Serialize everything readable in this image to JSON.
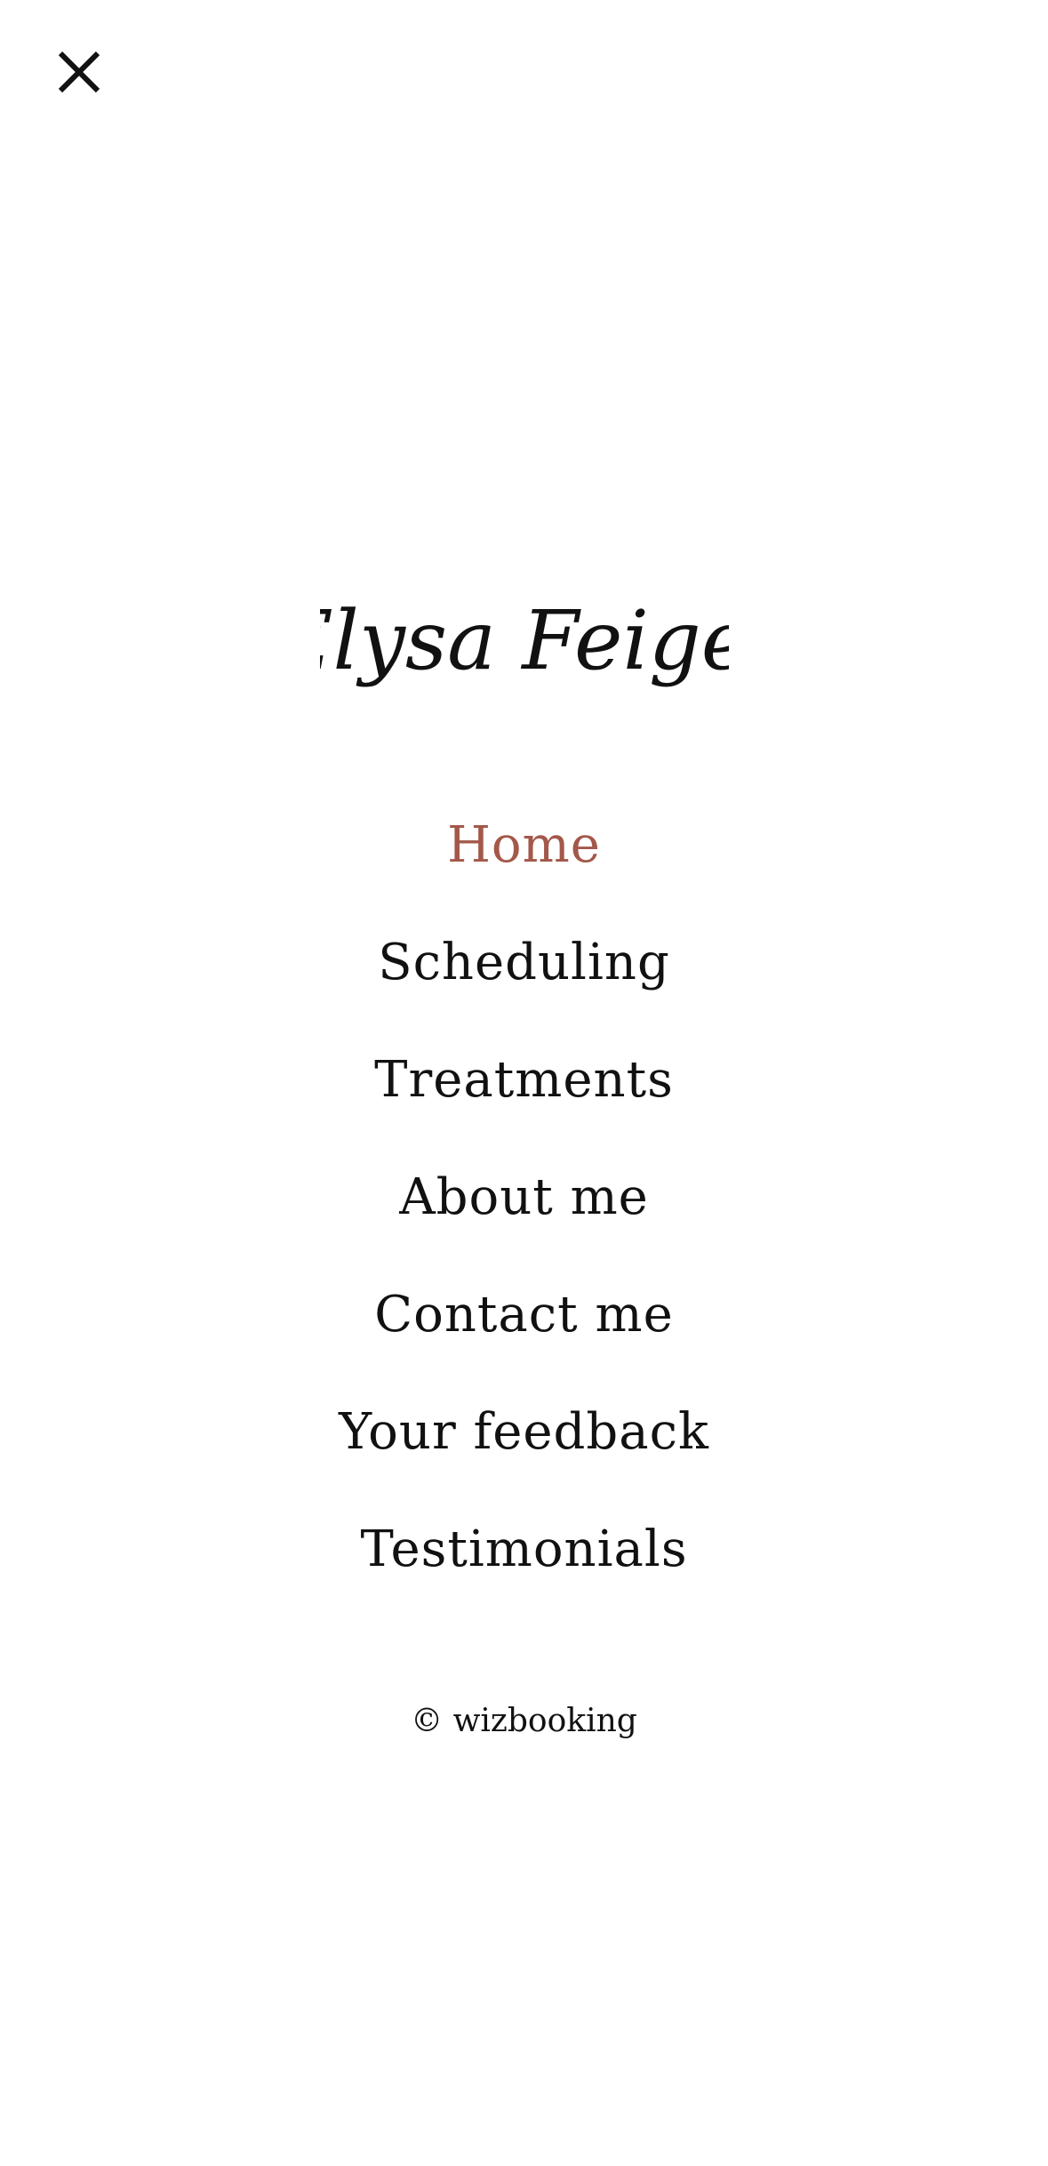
{
  "header": {
    "close_icon": "close-icon"
  },
  "brand": {
    "name": "Elysa Feigel"
  },
  "nav": {
    "items": [
      {
        "label": "Home",
        "active": true
      },
      {
        "label": "Scheduling",
        "active": false
      },
      {
        "label": "Treatments",
        "active": false
      },
      {
        "label": "About me",
        "active": false
      },
      {
        "label": "Contact me",
        "active": false
      },
      {
        "label": "Your feedback",
        "active": false
      },
      {
        "label": "Testimonials",
        "active": false
      }
    ]
  },
  "footer": {
    "copyright": "© wizbooking"
  },
  "colors": {
    "background": "#ffffff",
    "text": "#111111",
    "active": "#a3584a"
  }
}
